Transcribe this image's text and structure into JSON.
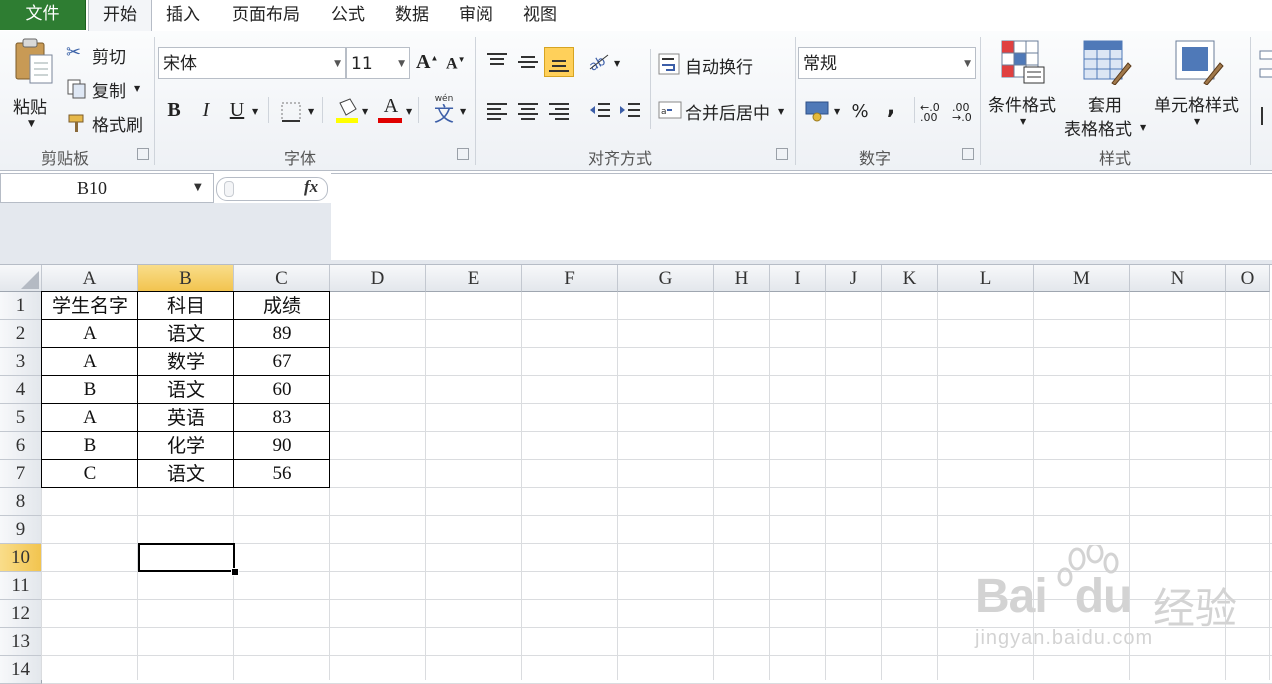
{
  "tabs": {
    "file": "文件",
    "items": [
      "开始",
      "插入",
      "页面布局",
      "公式",
      "数据",
      "审阅",
      "视图"
    ]
  },
  "ribbon": {
    "clipboard": {
      "paste": "粘贴",
      "cut": "剪切",
      "copy": "复制",
      "format_painter": "格式刷",
      "label": "剪贴板"
    },
    "font": {
      "name": "宋体",
      "size": "11",
      "bold": "B",
      "italic": "I",
      "underline": "U",
      "font_color_glyph": "A",
      "phonetic_glyph": "wén",
      "label": "字体",
      "fill_color": "#ffff00",
      "font_color": "#e00000"
    },
    "alignment": {
      "wrap_text": "自动换行",
      "merge_center": "合并后居中",
      "label": "对齐方式"
    },
    "number": {
      "format": "常规",
      "percent": "%",
      "comma": ",",
      "label": "数字"
    },
    "styles": {
      "conditional": "条件格式",
      "table_format_1": "套用",
      "table_format_2": "表格格式",
      "cell_styles": "单元格样式",
      "label": "样式"
    }
  },
  "formula_bar": {
    "name_box": "B10",
    "fx": "fx",
    "value": ""
  },
  "sheet": {
    "columns": [
      "A",
      "B",
      "C",
      "D",
      "E",
      "F",
      "G",
      "H",
      "I",
      "J",
      "K",
      "L",
      "M",
      "N",
      "O"
    ],
    "rows": [
      "1",
      "2",
      "3",
      "4",
      "5",
      "6",
      "7",
      "8",
      "9",
      "10",
      "11",
      "12",
      "13",
      "14"
    ],
    "selected_column": "B",
    "selected_row": "10",
    "headers": [
      "学生名字",
      "科目",
      "成绩"
    ],
    "data": [
      [
        "A",
        "语文",
        "89"
      ],
      [
        "A",
        "数学",
        "67"
      ],
      [
        "B",
        "语文",
        "60"
      ],
      [
        "A",
        "英语",
        "83"
      ],
      [
        "B",
        "化学",
        "90"
      ],
      [
        "C",
        "语文",
        "56"
      ]
    ]
  },
  "watermark": {
    "brand_latin": "Bai",
    "brand_latin_2": "du",
    "brand_cjk": "经验",
    "url": "jingyan.baidu.com"
  }
}
